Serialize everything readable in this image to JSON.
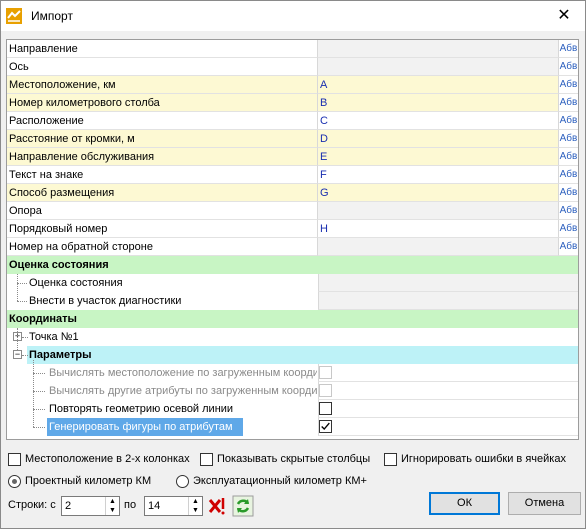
{
  "window": {
    "title": "Импорт",
    "close_glyph": "✕"
  },
  "grid": {
    "rows": [
      {
        "name": "Направление",
        "value": "",
        "abv": "Абв",
        "style": "white",
        "warn": false
      },
      {
        "name": "Ось",
        "value": "",
        "abv": "Абв",
        "style": "white",
        "warn": false
      },
      {
        "name": "Местоположение, км",
        "value": "A",
        "abv": "Абв",
        "style": "yellow",
        "warn": true
      },
      {
        "name": "Номер километрового столба",
        "value": "B",
        "abv": "Абв",
        "style": "yellow",
        "warn": true
      },
      {
        "name": "Расположение",
        "value": "C",
        "abv": "Абв",
        "style": "white",
        "warn": false
      },
      {
        "name": "Расстояние от кромки, м",
        "value": "D",
        "abv": "Абв",
        "style": "yellow",
        "warn": true
      },
      {
        "name": "Направление обслуживания",
        "value": "E",
        "abv": "Абв",
        "style": "yellow",
        "warn": true
      },
      {
        "name": "Текст на знаке",
        "value": "F",
        "abv": "Абв",
        "style": "white",
        "warn": false
      },
      {
        "name": "Способ размещения",
        "value": "G",
        "abv": "Абв",
        "style": "yellow",
        "warn": true
      },
      {
        "name": "Опора",
        "value": "",
        "abv": "Абв",
        "style": "white",
        "warn": false
      },
      {
        "name": "Порядковый номер",
        "value": "H",
        "abv": "Абв",
        "style": "white",
        "warn": false
      },
      {
        "name": "Номер на обратной стороне",
        "value": "",
        "abv": "Абв",
        "style": "white",
        "warn": false
      }
    ],
    "section_condition": "Оценка состояния",
    "condition_items": [
      "Оценка состояния",
      "Внести в участок диагностики"
    ],
    "section_coords": "Координаты",
    "point1": "Точка №1",
    "section_params": "Параметры",
    "params": [
      {
        "label": "Вычислять местоположение по загруженным коорди",
        "disabled": true,
        "checked": false
      },
      {
        "label": "Вычислять другие атрибуты по загруженным коорди",
        "disabled": true,
        "checked": false
      },
      {
        "label": "Повторять геометрию осевой линии",
        "disabled": false,
        "checked": false
      },
      {
        "label": "Генерировать фигуры по атрибутам",
        "disabled": false,
        "checked": true
      }
    ]
  },
  "options": {
    "location_2col": "Местоположение в 2-х колонках",
    "show_hidden": "Показывать скрытые столбцы",
    "ignore_errors": "Игнорировать ошибки в ячейках",
    "radio_project": "Проектный километр КМ",
    "radio_operational": "Эксплуатационный километр КМ+"
  },
  "rows_range": {
    "label_from": "Строки: с",
    "from": "2",
    "label_to": "по",
    "to": "14"
  },
  "buttons": {
    "ok": "ОК",
    "cancel": "Отмена"
  },
  "colors": {
    "yellow": "#fdf9d3",
    "green": "#c8f5c4",
    "cyan": "#bdf2f7",
    "selection": "#5fa8e8"
  }
}
